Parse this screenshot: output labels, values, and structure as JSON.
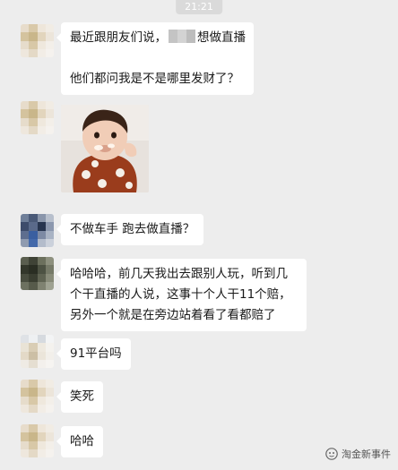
{
  "timestamp": "21:21",
  "messages": [
    {
      "id": "m1",
      "lines": [
        "最近跟朋友们说，",
        "想做直播",
        "",
        "他们都问我是不是哪里发财了？"
      ]
    },
    {
      "id": "m2",
      "type": "image",
      "image_desc": "baby-eating-sticker"
    },
    {
      "id": "m3",
      "lines": [
        "不做车手 跑去做直播？"
      ]
    },
    {
      "id": "m4",
      "lines": [
        "哈哈哈，前几天我出去跟别人玩，听到几",
        "个干直播的人说，这事十个人干11个赔，",
        "另外一个就是在旁边站着看了看都赔了"
      ]
    },
    {
      "id": "m5",
      "lines": [
        "91平台吗"
      ]
    },
    {
      "id": "m6",
      "lines": [
        "笑死"
      ]
    },
    {
      "id": "m7",
      "lines": [
        "哈哈"
      ]
    }
  ],
  "watermark": {
    "text": "淘金新事件",
    "icon": "wechat-official-account-icon"
  },
  "colors": {
    "background": "#ededed",
    "bubble": "#ffffff",
    "text": "#191919"
  }
}
